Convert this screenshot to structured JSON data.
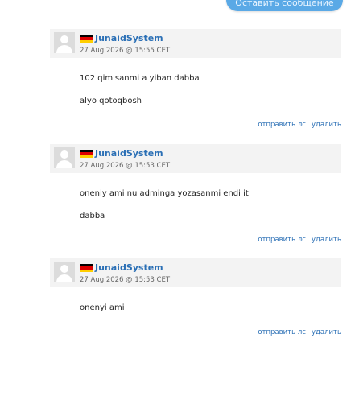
{
  "top_button": {
    "label": "Оставить сообщение"
  },
  "colors": {
    "accent": "#2a6fb5",
    "button": "#5aa9e6",
    "header_bg": "#f3f3f3"
  },
  "comments": [
    {
      "username": "JunaidSystem",
      "flag_icon": "germany-flag-icon",
      "timestamp": "27 Aug 2026 @ 15:55 CET",
      "messages": [
        "102 qimisanmi a yiban dabba",
        "alyo qotoqbosh"
      ],
      "actions": {
        "send_pm": "отправить лс",
        "delete": "удалить"
      }
    },
    {
      "username": "JunaidSystem",
      "flag_icon": "germany-flag-icon",
      "timestamp": "27 Aug 2026 @ 15:53 CET",
      "messages": [
        "oneniy ami nu adminga yozasanmi endi it",
        "dabba"
      ],
      "actions": {
        "send_pm": "отправить лс",
        "delete": "удалить"
      }
    },
    {
      "username": "JunaidSystem",
      "flag_icon": "germany-flag-icon",
      "timestamp": "27 Aug 2026 @ 15:53 CET",
      "messages": [
        "onenyi ami"
      ],
      "actions": {
        "send_pm": "отправить лс",
        "delete": "удалить"
      }
    }
  ]
}
